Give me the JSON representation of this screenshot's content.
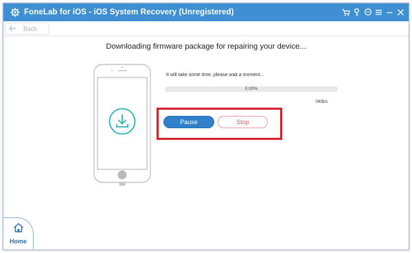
{
  "window": {
    "title": "FoneLab for iOS - iOS System Recovery (Unregistered)",
    "logo_icon": "gear-icon",
    "title_buttons": [
      {
        "name": "cart-icon"
      },
      {
        "name": "key-icon"
      },
      {
        "name": "chat-icon"
      },
      {
        "name": "menu-icon"
      },
      {
        "name": "minimize-icon"
      },
      {
        "name": "close-icon"
      }
    ]
  },
  "toolbar": {
    "back_label": "Back",
    "back_icon": "back-arrow-icon"
  },
  "main": {
    "heading": "Downloading firmware package for repairing your device...",
    "wait_text": "It will take some time, please wait a moment...",
    "progress": {
      "percent_label": "0.00%",
      "value": 0
    },
    "speed": "0KB/s",
    "pause_label": "Pause",
    "stop_label": "Stop"
  },
  "nav": {
    "home_label": "Home",
    "home_icon": "home-icon"
  },
  "colors": {
    "accent": "#3f8fd3",
    "button_primary": "#2f7fc9",
    "highlight": "#d51f2a",
    "stop_text": "#e05a63",
    "teal_icon": "#2bb3b8"
  }
}
